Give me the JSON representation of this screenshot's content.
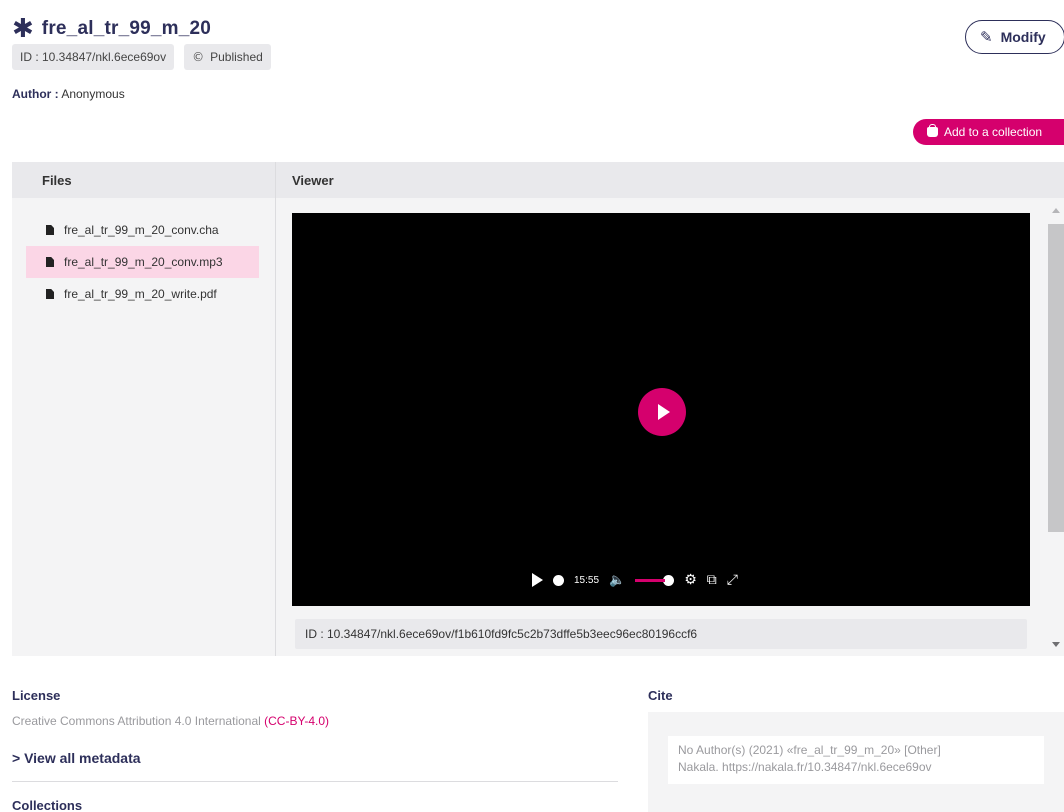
{
  "header": {
    "title": "fre_al_tr_99_m_20",
    "id_badge": "ID : 10.34847/nkl.6ece69ov",
    "status_badge": "Published",
    "author_label": "Author :",
    "author_value": "Anonymous",
    "modify_label": "Modify",
    "add_collection_label": "Add to a collection"
  },
  "panel": {
    "files_title": "Files",
    "viewer_title": "Viewer",
    "files": [
      {
        "name": "fre_al_tr_99_m_20_conv.cha",
        "active": false
      },
      {
        "name": "fre_al_tr_99_m_20_conv.mp3",
        "active": true
      },
      {
        "name": "fre_al_tr_99_m_20_write.pdf",
        "active": false
      }
    ],
    "player": {
      "time": "15:55"
    },
    "file_id": "ID : 10.34847/nkl.6ece69ov/f1b610fd9fc5c2b73dffe5b3eec96ec80196ccf6"
  },
  "license": {
    "label": "License",
    "text": "Creative Commons Attribution 4.0 International",
    "code": "(CC-BY-4.0)",
    "view_metadata": "> View all metadata",
    "collections_label": "Collections"
  },
  "cite": {
    "label": "Cite",
    "line1": "No Author(s) (2021) «fre_al_tr_99_m_20» [Other]",
    "line2": "Nakala. https://nakala.fr/10.34847/nkl.6ece69ov"
  },
  "colors": {
    "accent": "#d5006d",
    "heading": "#2d2f5a",
    "panel_bg": "#f4f4f5",
    "active_file_bg": "#fbd6e6"
  },
  "icons": {
    "title": "asterisk-icon",
    "published": "copyright-icon",
    "modify": "pencil-icon",
    "collection": "bag-icon",
    "file": "file-icon"
  }
}
